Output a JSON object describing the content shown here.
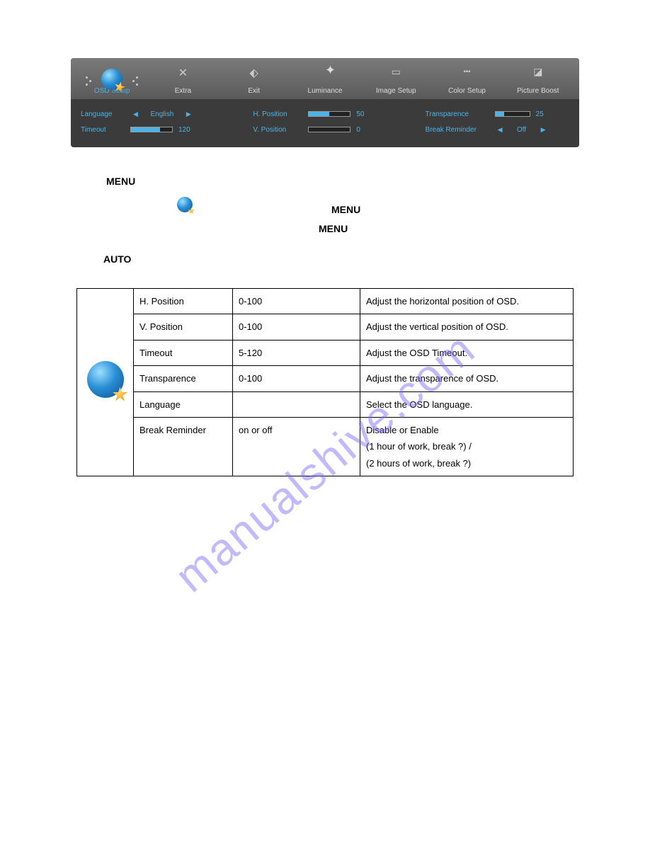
{
  "osd": {
    "tabs": [
      "OSD Setup",
      "Extra",
      "Exit",
      "Luminance",
      "Image Setup",
      "Color Setup",
      "Picture Boost"
    ],
    "left": {
      "language_label": "Language",
      "language_value": "English",
      "timeout_label": "Timeout",
      "timeout_value": "120"
    },
    "mid": {
      "hpos_label": "H. Position",
      "hpos_value": "50",
      "vpos_label": "V. Position",
      "vpos_value": "0"
    },
    "right": {
      "trans_label": "Transparence",
      "trans_value": "25",
      "break_label": "Break Reminder",
      "break_value": "Off"
    }
  },
  "doc_words": {
    "menu1": "MENU",
    "menu2": "MENU",
    "menu3": "MENU",
    "auto": "AUTO"
  },
  "table": {
    "rows": [
      {
        "name": "H. Position",
        "range": "0-100",
        "desc": "Adjust the horizontal position of OSD."
      },
      {
        "name": "V. Position",
        "range": "0-100",
        "desc": "Adjust the vertical position of OSD."
      },
      {
        "name": "Timeout",
        "range": "5-120",
        "desc": "Adjust the OSD Timeout."
      },
      {
        "name": "Transparence",
        "range": "0-100",
        "desc": "Adjust the transparence of OSD."
      },
      {
        "name": "Language",
        "range": "",
        "desc": "Select the OSD language."
      },
      {
        "name": "Break Reminder",
        "range": "on or off",
        "desc": "Disable or Enable\n(1 hour of work, break ?) /\n(2 hours of work, break ?)"
      }
    ]
  },
  "watermark": "manualshive.com"
}
